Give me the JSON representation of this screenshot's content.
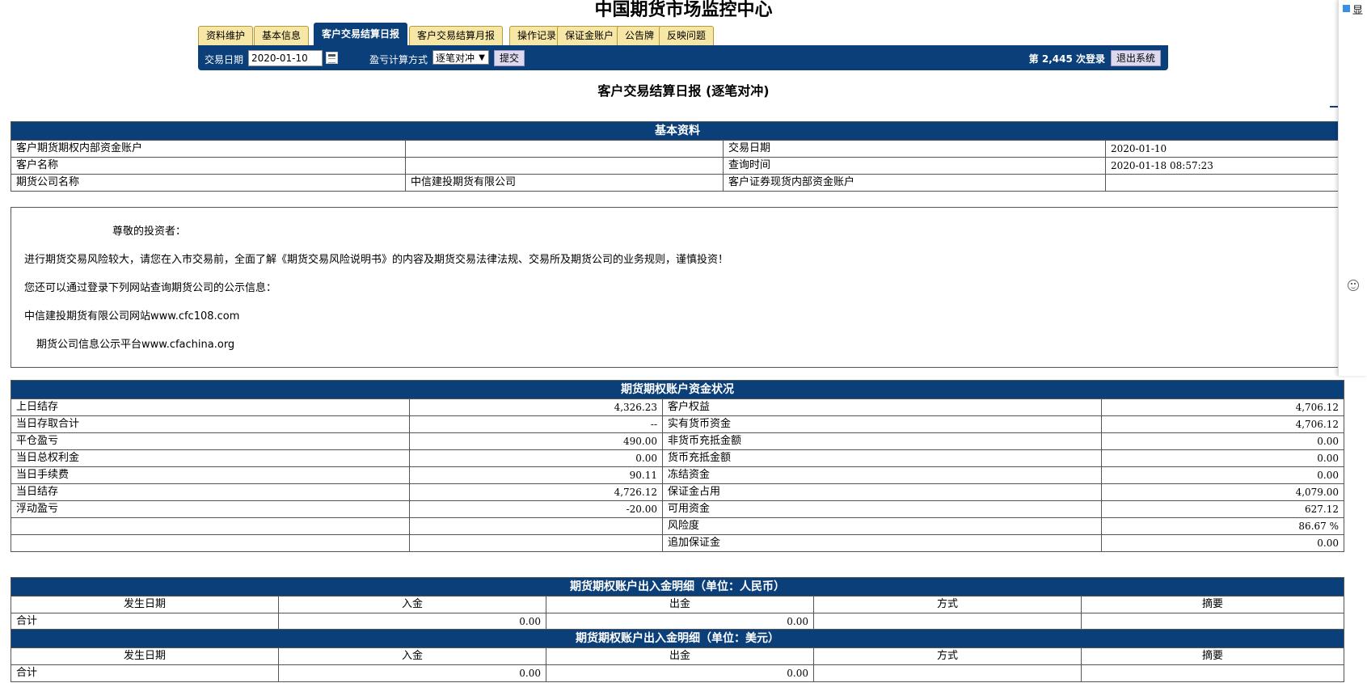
{
  "site_title": "中国期货市场监控中心",
  "tabs": [
    "资料维护",
    "基本信息",
    "客户交易结算日报",
    "客户交易结算月报",
    "操作记录",
    "保证金账户",
    "公告牌",
    "反映问题"
  ],
  "toolbar": {
    "date_label": "交易日期",
    "date_value": "2020-01-10",
    "calc_label": "盈亏计算方式",
    "calc_value": "逐笔对冲",
    "submit": "提交",
    "login_count": "第 2,445 次登录",
    "logout": "退出系统"
  },
  "report_title": "客户交易结算日报 (逐笔对冲)",
  "basic": {
    "header": "基本资料",
    "account_label": "客户期货期权内部资金账户",
    "account_value": "",
    "trade_date_label": "交易日期",
    "trade_date_value": "2020-01-10",
    "name_label": "客户名称",
    "name_value": "",
    "query_time_label": "查询时间",
    "query_time_value": "2020-01-18 08:57:23",
    "company_label": "期货公司名称",
    "company_value": "中信建投期货有限公司",
    "securities_label": "客户证券现货内部资金账户",
    "securities_value": ""
  },
  "notice": {
    "greeting": "尊敬的投资者：",
    "line1": "进行期货交易风险较大，请您在入市交易前，全面了解《期货交易风险说明书》的内容及期货交易法律法规、交易所及期货公司的业务规则，谨慎投资！",
    "line2": "您还可以通过登录下列网站查询期货公司的公示信息：",
    "line3": "中信建投期货有限公司网站www.cfc108.com",
    "line4": "期货公司信息公示平台www.cfachina.org"
  },
  "funds": {
    "header": "期货期权账户资金状况",
    "rows": [
      {
        "l_label": "上日结存",
        "l_value": "4,326.23",
        "r_label": "客户权益",
        "r_value": "4,706.12"
      },
      {
        "l_label": "当日存取合计",
        "l_value": "--",
        "r_label": "实有货币资金",
        "r_value": "4,706.12"
      },
      {
        "l_label": "平仓盈亏",
        "l_value": "490.00",
        "r_label": "非货币充抵金额",
        "r_value": "0.00"
      },
      {
        "l_label": "当日总权利金",
        "l_value": "0.00",
        "r_label": "货币充抵金额",
        "r_value": "0.00"
      },
      {
        "l_label": "当日手续费",
        "l_value": "90.11",
        "r_label": "冻结资金",
        "r_value": "0.00"
      },
      {
        "l_label": "当日结存",
        "l_value": "4,726.12",
        "r_label": "保证金占用",
        "r_value": "4,079.00"
      },
      {
        "l_label": "浮动盈亏",
        "l_value": "-20.00",
        "r_label": "可用资金",
        "r_value": "627.12"
      },
      {
        "l_label": "",
        "l_value": "",
        "r_label": "风险度",
        "r_value": "86.67 %"
      },
      {
        "l_label": "",
        "l_value": "",
        "r_label": "追加保证金",
        "r_value": "0.00"
      }
    ]
  },
  "rmb": {
    "header": "期货期权账户出入金明细（单位：人民币）",
    "columns": [
      "发生日期",
      "入金",
      "出金",
      "方式",
      "摘要"
    ],
    "total_label": "合计",
    "in_total": "0.00",
    "out_total": "0.00"
  },
  "usd": {
    "header": "期货期权账户出入金明细（单位：美元）",
    "columns": [
      "发生日期",
      "入金",
      "出金",
      "方式",
      "摘要"
    ],
    "total_label": "合计",
    "in_total": "0.00",
    "out_total": "0.00"
  },
  "side_panel": {
    "text": "显"
  }
}
